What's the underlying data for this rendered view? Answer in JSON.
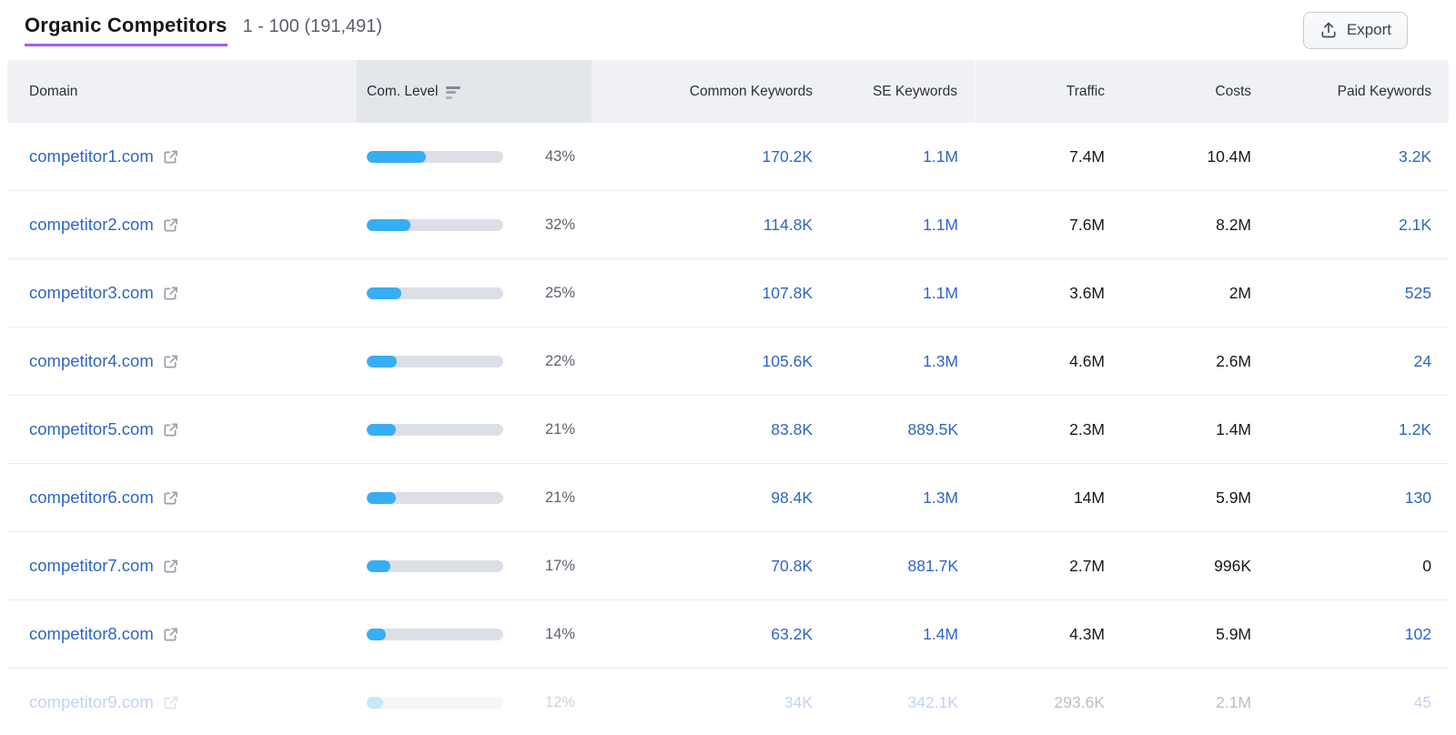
{
  "page": {
    "title": "Organic Competitors",
    "range_text": "1 - 100 (191,491)",
    "export_label": "Export"
  },
  "table": {
    "columns": {
      "domain": "Domain",
      "com_level": "Com. Level",
      "common_keywords": "Common Keywords",
      "se_keywords": "SE Keywords",
      "traffic": "Traffic",
      "costs": "Costs",
      "paid_keywords": "Paid Keywords"
    },
    "sorted_column": "Com. Level",
    "sort_direction": "descending",
    "rows": [
      {
        "domain": "competitor1.com",
        "com_level_pct": 43,
        "com_level_text": "43%",
        "common_keywords": "170.2K",
        "se_keywords": "1.1M",
        "traffic": "7.4M",
        "costs": "10.4M",
        "paid_keywords": "3.2K",
        "paid_is_link": true,
        "faded": false
      },
      {
        "domain": "competitor2.com",
        "com_level_pct": 32,
        "com_level_text": "32%",
        "common_keywords": "114.8K",
        "se_keywords": "1.1M",
        "traffic": "7.6M",
        "costs": "8.2M",
        "paid_keywords": "2.1K",
        "paid_is_link": true,
        "faded": false
      },
      {
        "domain": "competitor3.com",
        "com_level_pct": 25,
        "com_level_text": "25%",
        "common_keywords": "107.8K",
        "se_keywords": "1.1M",
        "traffic": "3.6M",
        "costs": "2M",
        "paid_keywords": "525",
        "paid_is_link": true,
        "faded": false
      },
      {
        "domain": "competitor4.com",
        "com_level_pct": 22,
        "com_level_text": "22%",
        "common_keywords": "105.6K",
        "se_keywords": "1.3M",
        "traffic": "4.6M",
        "costs": "2.6M",
        "paid_keywords": "24",
        "paid_is_link": true,
        "faded": false
      },
      {
        "domain": "competitor5.com",
        "com_level_pct": 21,
        "com_level_text": "21%",
        "common_keywords": "83.8K",
        "se_keywords": "889.5K",
        "traffic": "2.3M",
        "costs": "1.4M",
        "paid_keywords": "1.2K",
        "paid_is_link": true,
        "faded": false
      },
      {
        "domain": "competitor6.com",
        "com_level_pct": 21,
        "com_level_text": "21%",
        "common_keywords": "98.4K",
        "se_keywords": "1.3M",
        "traffic": "14M",
        "costs": "5.9M",
        "paid_keywords": "130",
        "paid_is_link": true,
        "faded": false
      },
      {
        "domain": "competitor7.com",
        "com_level_pct": 17,
        "com_level_text": "17%",
        "common_keywords": "70.8K",
        "se_keywords": "881.7K",
        "traffic": "2.7M",
        "costs": "996K",
        "paid_keywords": "0",
        "paid_is_link": false,
        "faded": false
      },
      {
        "domain": "competitor8.com",
        "com_level_pct": 14,
        "com_level_text": "14%",
        "common_keywords": "63.2K",
        "se_keywords": "1.4M",
        "traffic": "4.3M",
        "costs": "5.9M",
        "paid_keywords": "102",
        "paid_is_link": true,
        "faded": false
      },
      {
        "domain": "competitor9.com",
        "com_level_pct": 12,
        "com_level_text": "12%",
        "common_keywords": "34K",
        "se_keywords": "342.1K",
        "traffic": "293.6K",
        "costs": "2.1M",
        "paid_keywords": "45",
        "paid_is_link": true,
        "faded": true
      }
    ]
  },
  "icons": {
    "export": "upload-icon",
    "sort": "sort-descending-icon",
    "domain_external": "external-link-icon"
  },
  "colors": {
    "accent_purple": "#a25cf0",
    "link_blue": "#2d65c6",
    "bar_fill_blue": "#36aef3",
    "bar_track_gray": "#dcdfe6",
    "header_bg": "#f0f1f4",
    "sorted_column_bg": "#e3e6ea",
    "text_dark": "#15181e",
    "text_gray": "#5d636e"
  }
}
